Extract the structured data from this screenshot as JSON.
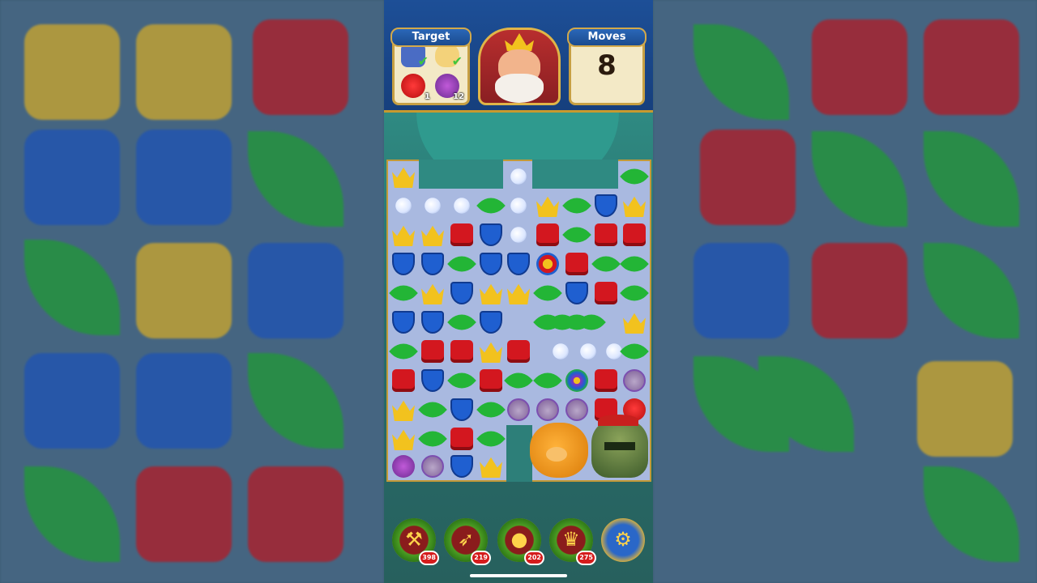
{
  "hud": {
    "target_label": "Target",
    "moves_label": "Moves",
    "moves_value": "8",
    "targets": [
      {
        "icon": "tv-icon",
        "done": true,
        "count": ""
      },
      {
        "icon": "bowl-icon",
        "done": true,
        "count": ""
      },
      {
        "icon": "red-bird-icon",
        "done": false,
        "count": "1"
      },
      {
        "icon": "purple-bird-icon",
        "done": false,
        "count": "12"
      }
    ]
  },
  "boosters": [
    {
      "name": "hammer-booster",
      "count": "398",
      "icon": "hammer-icon"
    },
    {
      "name": "arrow-booster",
      "count": "219",
      "icon": "arrow-icon"
    },
    {
      "name": "cannon-booster",
      "count": "202",
      "icon": "cannon-icon"
    },
    {
      "name": "jester-booster",
      "count": "275",
      "icon": "jester-hat-icon"
    },
    {
      "name": "settings",
      "count": "",
      "icon": "gear-icon"
    }
  ],
  "colors": {
    "crown": "#f2c21e",
    "shield": "#1f5fd0",
    "leaf": "#23b536",
    "box": "#d3171f"
  }
}
